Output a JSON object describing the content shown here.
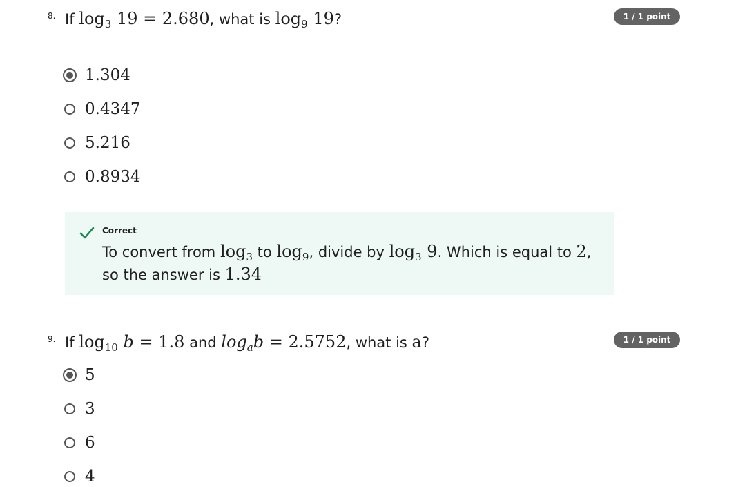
{
  "questions": [
    {
      "number": "8.",
      "prompt": {
        "p1": "If ",
        "log1_base": "3",
        "log1_arg": "19",
        "eq1": "= 2.680",
        "p2": ", what is ",
        "log2_base": "9",
        "log2_arg": "19",
        "p3": "?"
      },
      "points": "1 / 1 point",
      "options": [
        "1.304",
        "0.4347",
        "5.216",
        "0.8934"
      ],
      "selected_index": 0,
      "feedback": {
        "status": "Correct",
        "t1": "To convert from ",
        "fromBase": "3",
        "t2": " to ",
        "toBase": "9",
        "t3": ", divide by ",
        "divBase": "3",
        "divArg": "9",
        "t4": ". Which is equal to ",
        "val": "2",
        "t5": ", so the answer is ",
        "answer": "1.34"
      }
    },
    {
      "number": "9.",
      "prompt": {
        "p1": "If ",
        "log1_base": "10",
        "log1_arg": "b",
        "eq1": "= 1.8",
        "p2": " and ",
        "log2_word": "log",
        "log2_base": "a",
        "log2_arg": "b",
        "eq2": "= 2.5752",
        "p3": ", what is ",
        "var": "a",
        "p4": "?"
      },
      "points": "1 / 1 point",
      "options": [
        "5",
        "3",
        "6",
        "4"
      ],
      "selected_index": 0
    }
  ],
  "colors": {
    "badge": "#636363",
    "feedback_bg": "#eef8f4",
    "check": "#1e8a55"
  }
}
